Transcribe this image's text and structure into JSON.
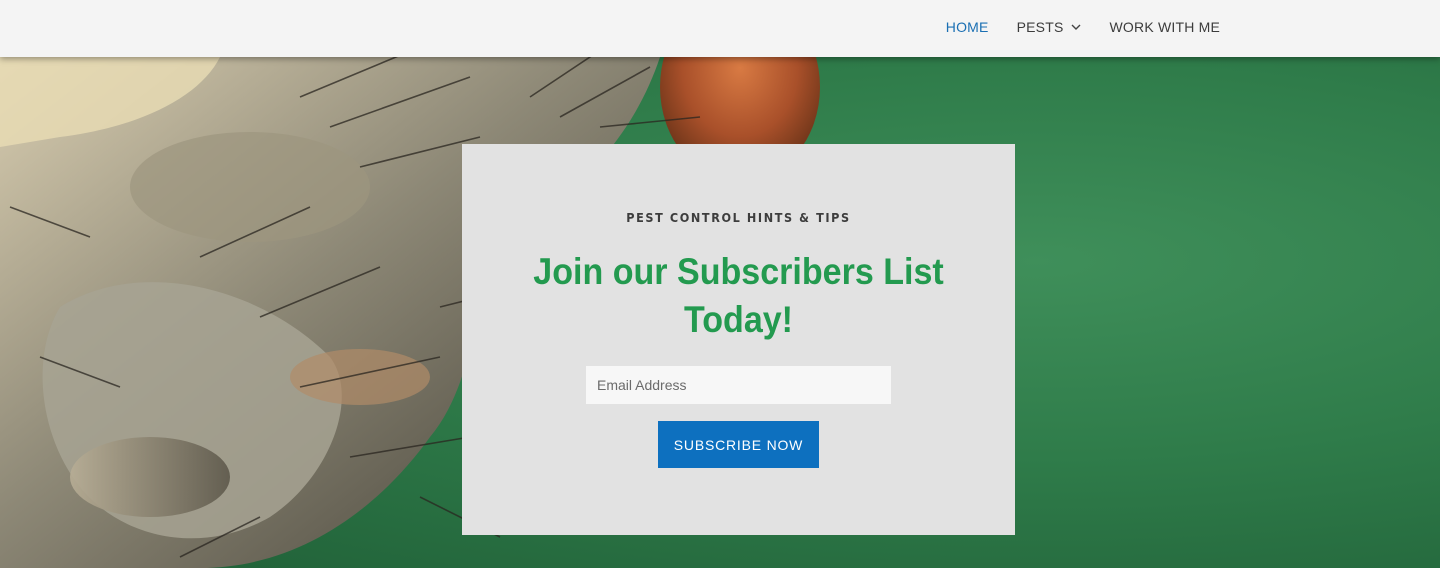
{
  "nav": {
    "items": [
      {
        "label": "HOME",
        "active": true
      },
      {
        "label": "PESTS",
        "has_dropdown": true
      },
      {
        "label": "WORK WITH ME"
      }
    ]
  },
  "hero": {
    "image_subject": "macro photo of a fly head",
    "background_color": "#2f7a49"
  },
  "signup": {
    "eyebrow": "PEST CONTROL HINTS & TIPS",
    "headline": "Join our Subscribers List Today!",
    "email_placeholder": "Email Address",
    "button_label": "SUBSCRIBE NOW"
  },
  "colors": {
    "accent_blue": "#0d70bf",
    "nav_active": "#1a6fb3",
    "headline_green": "#239a4f",
    "card_bg": "#e2e2e2"
  },
  "icons": {
    "dropdown": "chevron-down-icon"
  }
}
